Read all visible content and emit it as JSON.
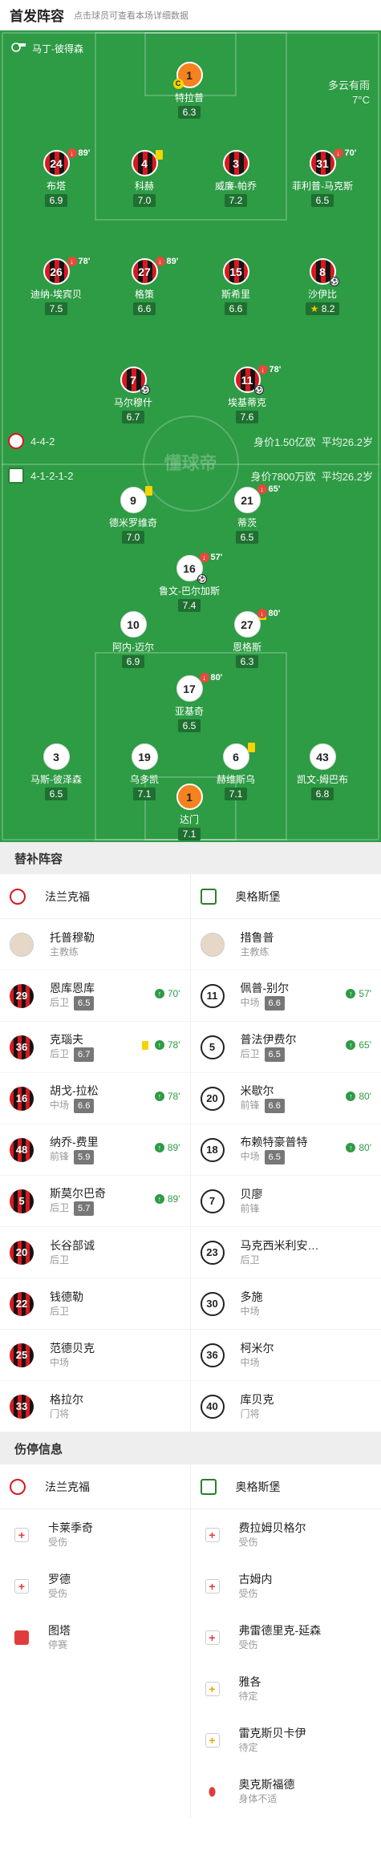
{
  "header": {
    "title": "首发阵容",
    "subtitle": "点击球员可查看本场详细数据"
  },
  "pitch": {
    "referee": "马丁-彼得森",
    "weather": "多云有雨",
    "temperature": "7°C",
    "watermark": "懂球帝",
    "home_formation": "4-4-2",
    "home_value": "身价1.50亿欧",
    "home_age": "平均26.2岁",
    "away_formation": "4-1-2-1-2",
    "away_value": "身价7800万欧",
    "away_age": "平均26.2岁",
    "players": [
      {
        "id": "h1",
        "side": "gk",
        "number": "1",
        "name": "特拉普",
        "rating": "6.3",
        "captain": "C"
      },
      {
        "id": "h24",
        "side": "home",
        "number": "24",
        "name": "布塔",
        "rating": "6.9",
        "sub": "89'"
      },
      {
        "id": "h4",
        "side": "home",
        "number": "4",
        "name": "科赫",
        "rating": "7.0",
        "yellow": true
      },
      {
        "id": "h3",
        "side": "home",
        "number": "3",
        "name": "威廉-帕乔",
        "rating": "7.2"
      },
      {
        "id": "h31",
        "side": "home",
        "number": "31",
        "name": "菲利普-马克斯",
        "rating": "6.5",
        "sub": "70'"
      },
      {
        "id": "h26",
        "side": "home",
        "number": "26",
        "name": "迪纳-埃宾贝",
        "rating": "7.5",
        "sub": "78'"
      },
      {
        "id": "h27",
        "side": "home",
        "number": "27",
        "name": "格策",
        "rating": "6.6",
        "sub": "89'"
      },
      {
        "id": "h15",
        "side": "home",
        "number": "15",
        "name": "斯希里",
        "rating": "6.6"
      },
      {
        "id": "h8",
        "side": "home",
        "number": "8",
        "name": "沙伊比",
        "rating": "8.2",
        "star": true,
        "goal": true
      },
      {
        "id": "h7",
        "side": "home",
        "number": "7",
        "name": "马尔穆什",
        "rating": "6.7",
        "goal": true
      },
      {
        "id": "h11",
        "side": "home",
        "number": "11",
        "name": "埃基蒂克",
        "rating": "7.6",
        "sub": "78'",
        "goal": true
      },
      {
        "id": "a9",
        "side": "away",
        "number": "9",
        "name": "德米罗维奇",
        "rating": "7.0",
        "yellow": true
      },
      {
        "id": "a21",
        "side": "away",
        "number": "21",
        "name": "蒂茨",
        "rating": "6.5",
        "sub": "65'"
      },
      {
        "id": "a16",
        "side": "away",
        "number": "16",
        "name": "鲁文-巴尔加斯",
        "rating": "7.4",
        "sub": "57'",
        "goal": true
      },
      {
        "id": "a10",
        "side": "away",
        "number": "10",
        "name": "阿内-迈尔",
        "rating": "6.9"
      },
      {
        "id": "a27",
        "side": "away",
        "number": "27",
        "name": "恩格斯",
        "rating": "6.3",
        "sub": "80'",
        "yellow": true
      },
      {
        "id": "a17",
        "side": "away",
        "number": "17",
        "name": "亚基奇",
        "rating": "6.5",
        "sub": "80'"
      },
      {
        "id": "a3",
        "side": "away",
        "number": "3",
        "name": "马斯-彼泽森",
        "rating": "6.5"
      },
      {
        "id": "a19",
        "side": "away",
        "number": "19",
        "name": "乌多凯",
        "rating": "7.1"
      },
      {
        "id": "a6",
        "side": "away",
        "number": "6",
        "name": "赫维斯乌",
        "rating": "7.1",
        "yellow": true
      },
      {
        "id": "a43",
        "side": "away",
        "number": "43",
        "name": "凯文-姆巴布",
        "rating": "6.8"
      },
      {
        "id": "a1",
        "side": "gk",
        "number": "1",
        "name": "达门",
        "rating": "7.1"
      }
    ]
  },
  "subs": {
    "title": "替补阵容",
    "home_team": "法兰克福",
    "away_team": "奥格斯堡",
    "home_coach": {
      "name": "托普穆勒",
      "role": "主教练"
    },
    "away_coach": {
      "name": "措鲁普",
      "role": "主教练"
    },
    "home": [
      {
        "number": "29",
        "name": "恩库恩库",
        "pos": "后卫",
        "rating": "6.5",
        "in": "70'"
      },
      {
        "number": "36",
        "name": "克瑙夫",
        "pos": "后卫",
        "rating": "6.7",
        "in": "78'",
        "yellow": true
      },
      {
        "number": "16",
        "name": "胡戈-拉松",
        "pos": "中场",
        "rating": "6.6",
        "in": "78'"
      },
      {
        "number": "48",
        "name": "纳乔-费里",
        "pos": "前锋",
        "rating": "5.9",
        "in": "89'"
      },
      {
        "number": "5",
        "name": "斯莫尔巴奇",
        "pos": "后卫",
        "rating": "5.7",
        "in": "89'"
      },
      {
        "number": "20",
        "name": "长谷部诚",
        "pos": "后卫"
      },
      {
        "number": "22",
        "name": "钱德勒",
        "pos": "后卫"
      },
      {
        "number": "25",
        "name": "范德贝克",
        "pos": "中场"
      },
      {
        "number": "33",
        "name": "格拉尔",
        "pos": "门将"
      }
    ],
    "away": [
      {
        "number": "11",
        "name": "佩普-别尔",
        "pos": "中场",
        "rating": "6.6",
        "in": "57'"
      },
      {
        "number": "5",
        "name": "普法伊费尔",
        "pos": "后卫",
        "rating": "6.5",
        "in": "65'"
      },
      {
        "number": "20",
        "name": "米歇尔",
        "pos": "前锋",
        "rating": "6.6",
        "in": "80'"
      },
      {
        "number": "18",
        "name": "布赖特豪普特",
        "pos": "中场",
        "rating": "6.5",
        "in": "80'"
      },
      {
        "number": "7",
        "name": "贝廖",
        "pos": "前锋"
      },
      {
        "number": "23",
        "name": "马克西米利安…",
        "pos": "后卫"
      },
      {
        "number": "30",
        "name": "多施",
        "pos": "中场"
      },
      {
        "number": "36",
        "name": "柯米尔",
        "pos": "中场"
      },
      {
        "number": "40",
        "name": "库贝克",
        "pos": "门将"
      }
    ]
  },
  "injuries": {
    "title": "伤停信息",
    "home_team": "法兰克福",
    "away_team": "奥格斯堡",
    "home": [
      {
        "name": "卡莱季奇",
        "status": "受伤",
        "icon": "injury-cross-icon"
      },
      {
        "name": "罗德",
        "status": "受伤",
        "icon": "injury-cross-icon"
      },
      {
        "name": "图塔",
        "status": "停赛",
        "icon": "red-card-icon"
      }
    ],
    "away": [
      {
        "name": "费拉姆贝格尔",
        "status": "受伤",
        "icon": "injury-cross-icon"
      },
      {
        "name": "古姆内",
        "status": "受伤",
        "icon": "injury-cross-icon"
      },
      {
        "name": "弗雷德里克-延森",
        "status": "受伤",
        "icon": "injury-cross-icon"
      },
      {
        "name": "雅各",
        "status": "待定",
        "icon": "doubtful-icon"
      },
      {
        "name": "雷克斯贝卡伊",
        "status": "待定",
        "icon": "doubtful-icon"
      },
      {
        "name": "奥克斯福德",
        "status": "身体不适",
        "icon": "pill-icon"
      }
    ]
  }
}
